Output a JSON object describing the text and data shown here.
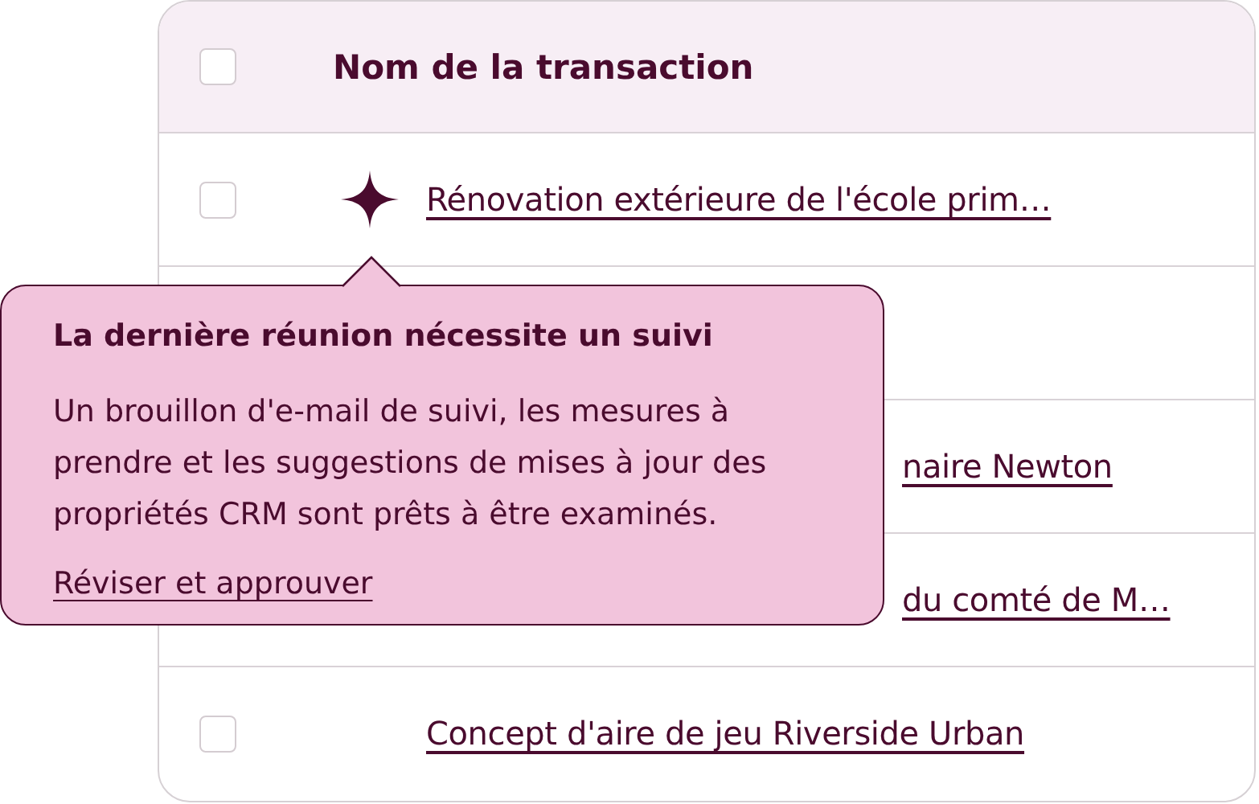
{
  "table": {
    "header": {
      "checked": false,
      "label": "Nom de la transaction"
    },
    "rows": [
      {
        "kind": "link",
        "checked": false,
        "sparkle": true,
        "name": "Rénovation extérieure de l'école prim…"
      },
      {
        "kind": "covered"
      },
      {
        "kind": "tail",
        "name": "naire Newton"
      },
      {
        "kind": "tail",
        "name": "du comté de M…"
      },
      {
        "kind": "link",
        "checked": false,
        "sparkle": false,
        "name": "Concept d'aire de jeu Riverside Urban"
      }
    ]
  },
  "tooltip": {
    "title": "La dernière réunion nécessite un suivi",
    "body": "Un brouillon d'e-mail de suivi, les mesures à prendre et les suggestions de mises à jour des propriétés CRM sont prêts à être examinés.",
    "link": "Réviser et approuver"
  }
}
